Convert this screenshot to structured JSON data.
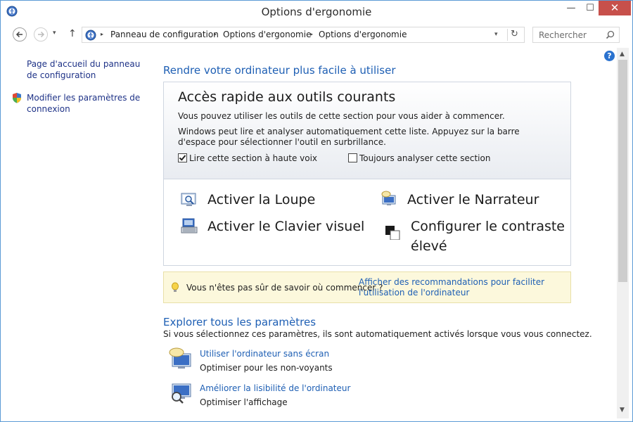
{
  "window": {
    "title": "Options d'ergonomie",
    "min": "—",
    "max": "☐",
    "close": "✕"
  },
  "nav": {
    "recent": "▾",
    "up": "↑",
    "crumbs": [
      "Panneau de configuration",
      "Options d'ergonomie",
      "Options d'ergonomie"
    ],
    "sep": "▸",
    "dropdown": "▾",
    "refresh": "↻",
    "search_placeholder": "Rechercher"
  },
  "left": {
    "link1": "Page d'accueil du panneau de configuration",
    "link2": "Modifier les paramètres de connexion"
  },
  "main": {
    "heading": "Rendre votre ordinateur plus facile à utiliser",
    "quick": {
      "title": "Accès rapide aux outils courants",
      "text1": "Vous pouvez utiliser les outils de cette section pour vous aider à commencer.",
      "text2": "Windows peut lire et analyser automatiquement cette liste. Appuyez sur la barre d'espace pour sélectionner l'outil en surbrillance.",
      "cb1_label": "Lire cette section à haute voix",
      "cb1_checked": true,
      "cb2_label": "Toujours analyser cette section",
      "cb2_checked": false,
      "tool_loupe": "Activer la Loupe",
      "tool_narrateur": "Activer le Narrateur",
      "tool_clavier": "Activer le Clavier visuel",
      "tool_contraste": "Configurer le contraste élevé"
    },
    "tip": {
      "question": "Vous n'êtes pas sûr de savoir où commencer ?",
      "link": "Afficher des recommandations pour faciliter l'utilisation de l'ordinateur"
    },
    "explore": {
      "heading": "Explorer tous les paramètres",
      "sub": "Si vous sélectionnez ces paramètres, ils sont automatiquement activés lorsque vous vous connectez.",
      "items": [
        {
          "link": "Utiliser l'ordinateur sans écran",
          "desc": "Optimiser pour les non-voyants"
        },
        {
          "link": "Améliorer la lisibilité de l'ordinateur",
          "desc": "Optimiser l'affichage"
        }
      ]
    }
  },
  "help": "?",
  "scroll": {
    "up": "▲",
    "down": "▼"
  },
  "colors": {
    "link": "#1e5fb4",
    "close": "#c7504b",
    "tip_bg": "#fcf8dc"
  }
}
